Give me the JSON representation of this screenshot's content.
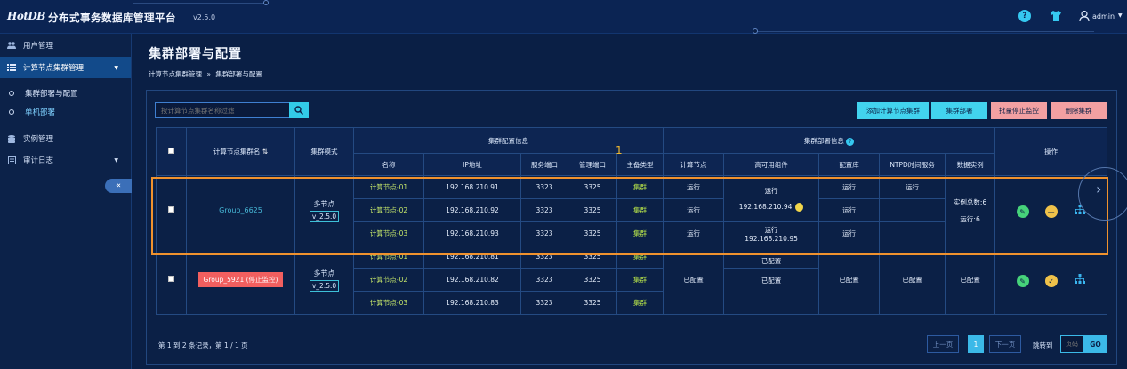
{
  "header": {
    "logo": "HotDB",
    "title": "分布式事务数据库管理平台",
    "version": "v2.5.0",
    "help_icon": "?",
    "user": "admin"
  },
  "sidebar": {
    "items": [
      {
        "label": "用户管理",
        "icon": "users-icon"
      },
      {
        "label": "计算节点集群管理",
        "icon": "list-icon"
      },
      {
        "label": "集群部署与配置",
        "icon": "circle-icon"
      },
      {
        "label": "单机部署",
        "icon": "circle-icon"
      },
      {
        "label": "实例管理",
        "icon": "database-icon"
      },
      {
        "label": "审计日志",
        "icon": "log-icon"
      }
    ],
    "collapse_label": "«"
  },
  "page": {
    "title": "集群部署与配置",
    "breadcrumb": [
      "计算节点集群管理",
      "»",
      "集群部署与配置"
    ]
  },
  "toolbar": {
    "search_placeholder": "按计算节点集群名称过滤",
    "buttons": [
      "添加计算节点集群",
      "集群部署",
      "批量停止监控",
      "删除集群"
    ]
  },
  "table": {
    "headers": {
      "name": "计算节点集群名",
      "mode": "集群模式",
      "config_group": "集群配置信息",
      "deploy_group": "集群部署信息",
      "ops": "操作",
      "sub": [
        "名称",
        "IP地址",
        "服务端口",
        "管理端口",
        "主备类型",
        "计算节点",
        "高可用组件",
        "配置库",
        "NTPD时间服务",
        "数据实例"
      ]
    },
    "groups": [
      {
        "name": "Group_6625",
        "mode": "多节点",
        "version": "v_2.5.0",
        "nodes": [
          {
            "name": "计算节点-01",
            "ip": "192.168.210.91",
            "service_port": "3323",
            "admin_port": "3325",
            "role": "集群",
            "compute": "运行",
            "config_db": "运行",
            "ntpd": "运行"
          },
          {
            "name": "计算节点-02",
            "ip": "192.168.210.92",
            "service_port": "3323",
            "admin_port": "3325",
            "role": "集群",
            "compute": "运行",
            "config_db": "运行",
            "ntpd": ""
          },
          {
            "name": "计算节点-03",
            "ip": "192.168.210.93",
            "service_port": "3323",
            "admin_port": "3325",
            "role": "集群",
            "compute": "运行",
            "config_db": "运行",
            "ntpd": ""
          }
        ],
        "ha": [
          {
            "status": "运行",
            "ip": "192.168.210.94"
          },
          {
            "status": "运行",
            "ip": "192.168.210.95"
          }
        ],
        "instances_total": "实例总数:6",
        "instances_running": "运行:6"
      },
      {
        "name": "Group_5921 (停止监控)",
        "mode": "多节点",
        "version": "v_2.5.0",
        "nodes": [
          {
            "name": "计算节点-01",
            "ip": "192.168.210.81",
            "service_port": "3323",
            "admin_port": "3325",
            "role": "集群"
          },
          {
            "name": "计算节点-02",
            "ip": "192.168.210.82",
            "service_port": "3323",
            "admin_port": "3325",
            "role": "集群"
          },
          {
            "name": "计算节点-03",
            "ip": "192.168.210.83",
            "service_port": "3323",
            "admin_port": "3325",
            "role": "集群"
          }
        ],
        "compute": "已配置",
        "ha": [
          "已配置",
          "已配置"
        ],
        "config_db": "已配置",
        "ntpd": "已配置",
        "instances": "已配置"
      }
    ]
  },
  "annotation": "1",
  "pager": {
    "info": "第 1 到 2 条记录，第 1 / 1 页",
    "prev": "上一页",
    "current": "1",
    "next": "下一页",
    "jump_label": "跳转到",
    "page_placeholder": "页码",
    "go": "GO"
  },
  "colors": {
    "accent": "#42d3ee",
    "danger": "#f25f5f",
    "highlight_box": "#f0922e"
  }
}
